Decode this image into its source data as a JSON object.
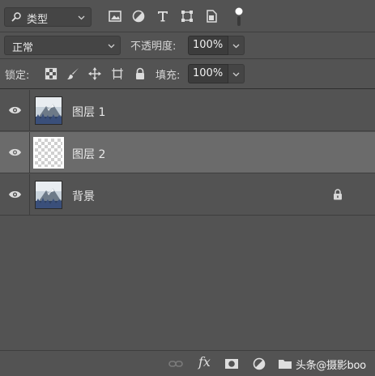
{
  "filter": {
    "kind_label": "类型",
    "icons": [
      "image-filter-icon",
      "adjustment-filter-icon",
      "type-filter-icon",
      "shape-filter-icon",
      "smart-object-filter-icon",
      "filter-toggle-icon"
    ]
  },
  "blend": {
    "mode": "正常",
    "opacity_label": "不透明度:",
    "opacity_value": "100%"
  },
  "lock": {
    "label": "锁定:",
    "fill_label": "填充:",
    "fill_value": "100%",
    "icons": [
      "lock-transparent-pixels-icon",
      "lock-image-pixels-icon",
      "lock-position-icon",
      "lock-artboard-icon",
      "lock-all-icon"
    ]
  },
  "layers": [
    {
      "name": "图层 1",
      "visible": true,
      "selected": false,
      "thumbnail": "landscape",
      "locked": false
    },
    {
      "name": "图层 2",
      "visible": true,
      "selected": true,
      "thumbnail": "transparent",
      "locked": false
    },
    {
      "name": "背景",
      "visible": true,
      "selected": false,
      "thumbnail": "landscape",
      "locked": true
    }
  ],
  "footer": {
    "icons": [
      "link-layers-icon",
      "layer-style-fx-icon",
      "add-mask-icon",
      "adjustment-layer-icon",
      "new-group-icon"
    ],
    "fx_label": "fx",
    "watermark": "头条@摄影boo"
  },
  "colors": {
    "panel_bg": "#535353",
    "selected_row": "#6b6b6b",
    "field_bg": "#3c3c3c",
    "text": "#e0e0e0"
  }
}
